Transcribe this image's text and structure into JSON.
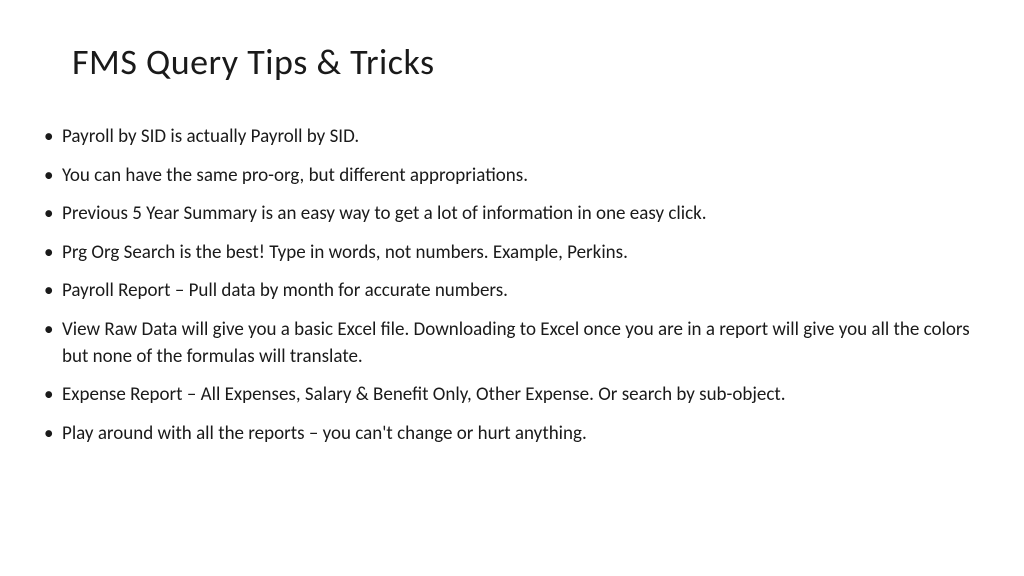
{
  "slide": {
    "title": "FMS Query Tips & Tricks",
    "bullets": [
      "Payroll by SID is actually Payroll by SID.",
      "You can have the same pro-org, but different appropriations.",
      "Previous 5 Year Summary is an easy way to get a lot of information in one easy click.",
      "Prg Org Search is the best!  Type in words, not numbers.  Example, Perkins.",
      "Payroll Report – Pull data by month for accurate numbers.",
      "View Raw Data will give you a basic Excel file.  Downloading to Excel once you are in a report will give you all the colors but none of the formulas will translate.",
      "Expense Report – All Expenses, Salary & Benefit Only, Other Expense.  Or search by sub-object.",
      "Play around with all the reports – you can't change or hurt anything."
    ]
  }
}
